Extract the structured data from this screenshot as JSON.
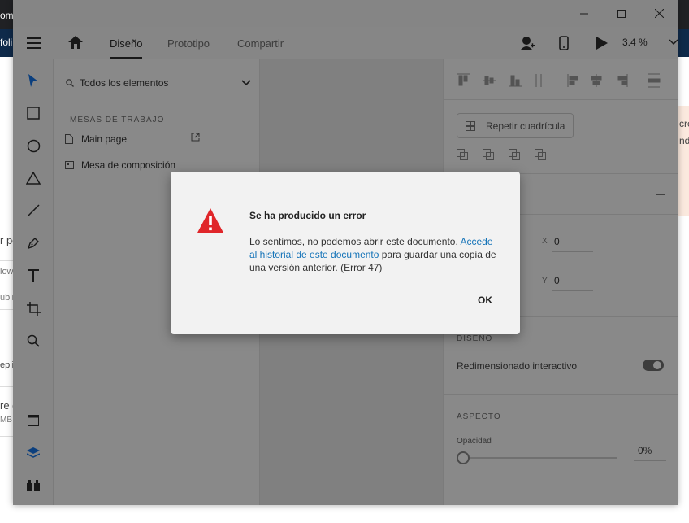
{
  "background": {
    "top_left_text": "om",
    "tab_text": "foli",
    "side_texts": [
      "r po",
      "low",
      "ublis",
      "epli",
      "re c",
      "MB -"
    ],
    "right_texts": [
      "cre",
      "nd"
    ]
  },
  "app": {
    "tabs": [
      {
        "label": "Diseño"
      },
      {
        "label": "Prototipo"
      },
      {
        "label": "Compartir"
      }
    ],
    "zoom": "3.4 %",
    "layers": {
      "search_label": "Todos los elementos",
      "section_title": "MESAS DE TRABAJO",
      "items": [
        {
          "label": "Main page"
        },
        {
          "label": "Mesa de composición"
        }
      ]
    },
    "props": {
      "repeat_grid": "Repetir cuadrícula",
      "x_label": "X",
      "x_value": "0",
      "y_label": "Y",
      "y_value": "0",
      "design_title": "DISEÑO",
      "responsive_resize": "Redimensionado interactivo",
      "appearance_title": "ASPECTO",
      "opacity_label": "Opacidad",
      "opacity_value": "0%"
    }
  },
  "dialog": {
    "title": "Se ha producido un error",
    "message_before": "Lo sentimos, no podemos abrir este documento. ",
    "link": "Accede al historial de este documento",
    "message_after": " para guardar una copia de una versión anterior. (Error 47)",
    "ok_label": "OK"
  },
  "colors": {
    "error_red": "#e0262a",
    "link_blue": "#1473b8",
    "accent_blue": "#1473e6"
  }
}
